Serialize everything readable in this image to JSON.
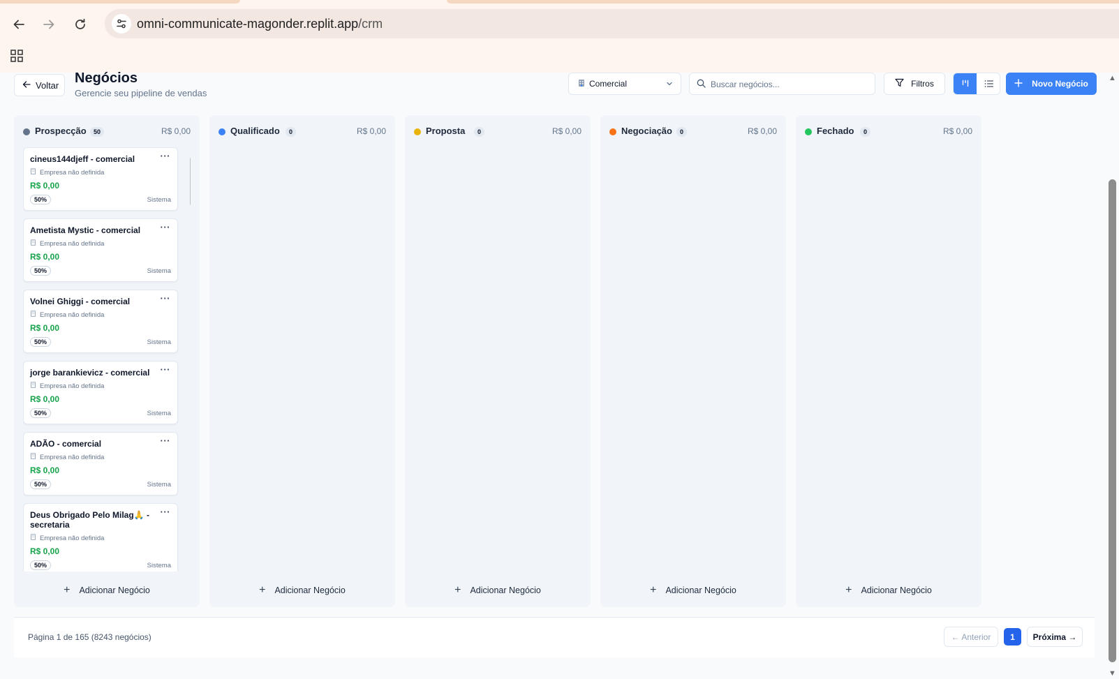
{
  "browser": {
    "url_host": "omni-communicate-magonder.replit.app",
    "url_path": "/crm"
  },
  "header": {
    "back_label": "Voltar",
    "title": "Negócios",
    "subtitle": "Gerencie seu pipeline de vendas",
    "pipeline_selected": "Comercial",
    "search_placeholder": "Buscar negócios...",
    "filters_label": "Filtros",
    "new_deal_label": "Novo Negócio"
  },
  "colors": {
    "accent": "#3b82f6",
    "value_green": "#16a34a"
  },
  "columns": [
    {
      "title": "Prospecção",
      "count": "50",
      "total": "R$ 0,00",
      "color": "#64748b",
      "add_label": "Adicionar Negócio"
    },
    {
      "title": "Qualificado",
      "count": "0",
      "total": "R$ 0,00",
      "color": "#3b82f6",
      "add_label": "Adicionar Negócio"
    },
    {
      "title": "Proposta",
      "count": "0",
      "total": "R$ 0,00",
      "color": "#eab308",
      "add_label": "Adicionar Negócio"
    },
    {
      "title": "Negociação",
      "count": "0",
      "total": "R$ 0,00",
      "color": "#f97316",
      "add_label": "Adicionar Negócio"
    },
    {
      "title": "Fechado",
      "count": "0",
      "total": "R$ 0,00",
      "color": "#22c55e",
      "add_label": "Adicionar Negócio"
    }
  ],
  "deals": [
    {
      "name": "cineus144djeff - comercial",
      "company": "Empresa não definida",
      "value": "R$ 0,00",
      "probability": "50%",
      "owner": "Sistema"
    },
    {
      "name": "Ametista Mystic - comercial",
      "company": "Empresa não definida",
      "value": "R$ 0,00",
      "probability": "50%",
      "owner": "Sistema"
    },
    {
      "name": "Volnei Ghiggi - comercial",
      "company": "Empresa não definida",
      "value": "R$ 0,00",
      "probability": "50%",
      "owner": "Sistema"
    },
    {
      "name": "jorge barankievicz - comercial",
      "company": "Empresa não definida",
      "value": "R$ 0,00",
      "probability": "50%",
      "owner": "Sistema"
    },
    {
      "name": "ADÃO - comercial",
      "company": "Empresa não definida",
      "value": "R$ 0,00",
      "probability": "50%",
      "owner": "Sistema"
    },
    {
      "name": "Deus Obrigado Pelo Milag🙏 - secretaria",
      "company": "Empresa não definida",
      "value": "R$ 0,00",
      "probability": "50%",
      "owner": "Sistema"
    }
  ],
  "deal_menu_glyph": "···",
  "pagination": {
    "info": "Página 1 de 165 (8243 negócios)",
    "prev_label": "← Anterior",
    "current_page": "1",
    "next_label": "Próxima →"
  }
}
